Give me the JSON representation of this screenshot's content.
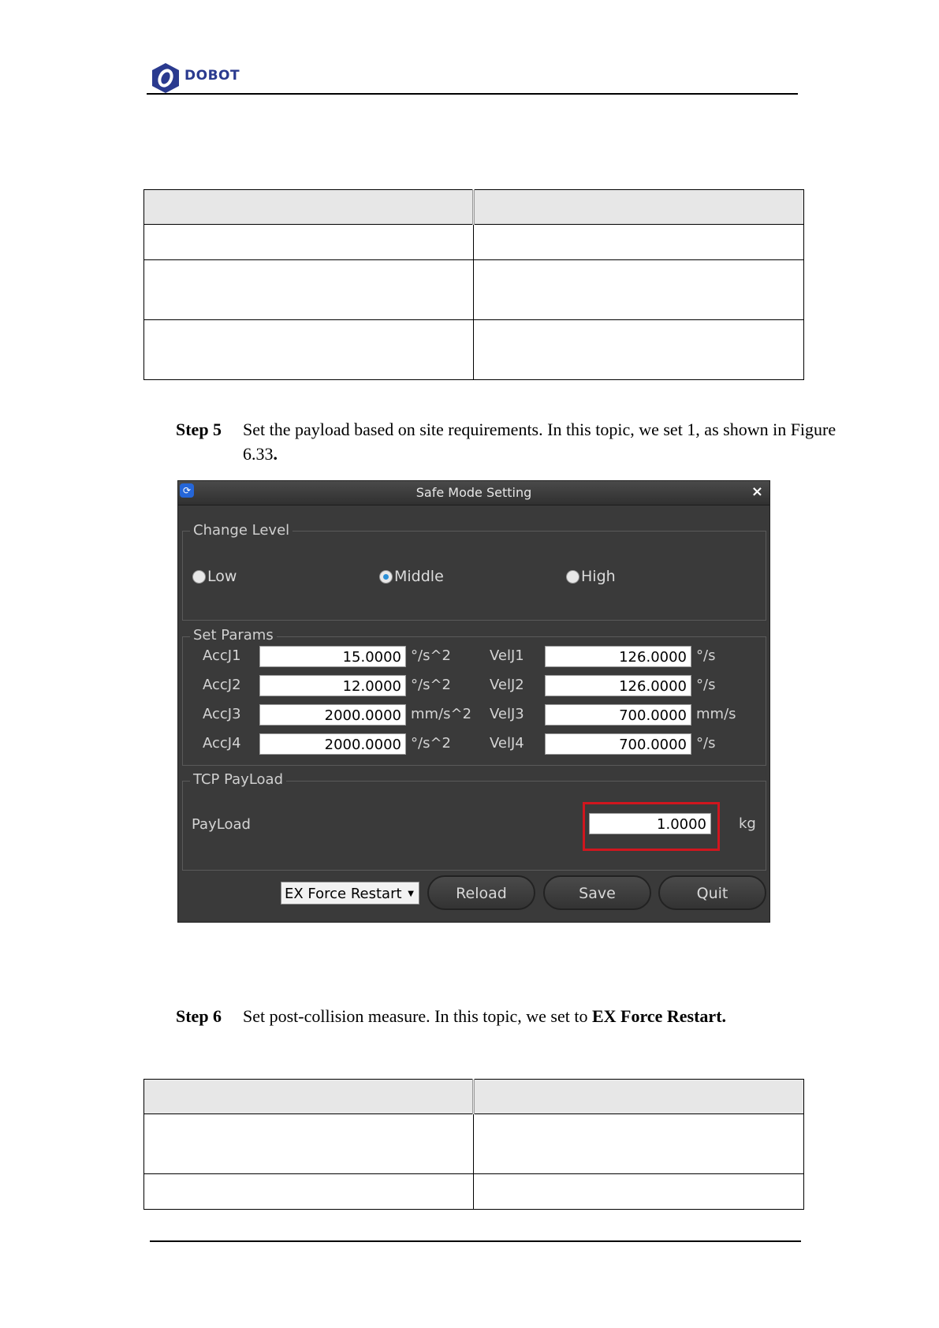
{
  "header": {
    "brand": "DOBOT"
  },
  "step5": {
    "label": "Step 5",
    "text_line1": "Set the payload based on site requirements. In this topic, we set 1, as shown in Figure",
    "text_line2_plain": "6.33",
    "text_line2_bold": "."
  },
  "step6": {
    "label": "Step 6",
    "text_plain": "Set post-collision measure. In this topic, we set to ",
    "text_bold": "EX Force Restart."
  },
  "dialog": {
    "title": "Safe Mode Setting",
    "close_glyph": "×",
    "icon_glyph": "⟳",
    "change_level": {
      "title": "Change Level",
      "options": [
        "Low",
        "Middle",
        "High"
      ],
      "selected": "Middle"
    },
    "set_params": {
      "title": "Set Params",
      "rows": [
        {
          "acc_label": "AccJ1",
          "acc_value": "15.0000",
          "acc_unit": "°/s^2",
          "vel_label": "VelJ1",
          "vel_value": "126.0000",
          "vel_unit": "°/s"
        },
        {
          "acc_label": "AccJ2",
          "acc_value": "12.0000",
          "acc_unit": "°/s^2",
          "vel_label": "VelJ2",
          "vel_value": "126.0000",
          "vel_unit": "°/s"
        },
        {
          "acc_label": "AccJ3",
          "acc_value": "2000.0000",
          "acc_unit": "mm/s^2",
          "vel_label": "VelJ3",
          "vel_value": "700.0000",
          "vel_unit": "mm/s"
        },
        {
          "acc_label": "AccJ4",
          "acc_value": "2000.0000",
          "acc_unit": "°/s^2",
          "vel_label": "VelJ4",
          "vel_value": "700.0000",
          "vel_unit": "°/s"
        }
      ]
    },
    "tcp_payload": {
      "title": "TCP PayLoad",
      "label": "PayLoad",
      "value": "1.0000",
      "unit": "kg"
    },
    "collision_combo": {
      "value": "EX Force Restart",
      "arrow_glyph": "▼"
    },
    "buttons": {
      "reload": "Reload",
      "save": "Save",
      "quit": "Quit"
    }
  },
  "colors": {
    "dialog_bg": "#3a3a3a",
    "highlight": "#d0161e",
    "brand": "#2a3a8f",
    "radio_selected": "#2b8fd6"
  }
}
